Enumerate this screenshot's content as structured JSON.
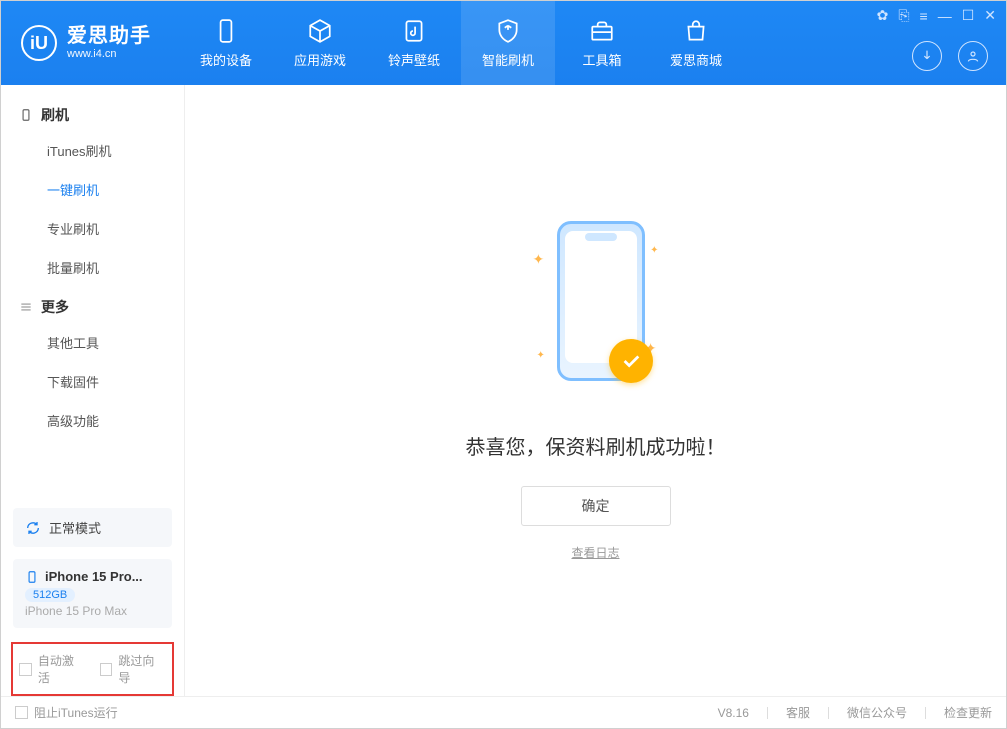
{
  "app": {
    "name_cn": "爱思助手",
    "url": "www.i4.cn",
    "logo_letters": "iU"
  },
  "nav": {
    "items": [
      {
        "label": "我的设备",
        "icon": "phone"
      },
      {
        "label": "应用游戏",
        "icon": "cube"
      },
      {
        "label": "铃声壁纸",
        "icon": "music"
      },
      {
        "label": "智能刷机",
        "icon": "shield",
        "active": true
      },
      {
        "label": "工具箱",
        "icon": "toolbox"
      },
      {
        "label": "爱思商城",
        "icon": "bag"
      }
    ]
  },
  "sidebar": {
    "group1": {
      "title": "刷机",
      "items": [
        "iTunes刷机",
        "一键刷机",
        "专业刷机",
        "批量刷机"
      ],
      "active_index": 1
    },
    "group2": {
      "title": "更多",
      "items": [
        "其他工具",
        "下载固件",
        "高级功能"
      ]
    }
  },
  "device_panel": {
    "mode_label": "正常模式",
    "name": "iPhone 15 Pro...",
    "storage": "512GB",
    "model": "iPhone 15 Pro Max"
  },
  "checkboxes": {
    "auto_activate": "自动激活",
    "skip_wizard": "跳过向导"
  },
  "main": {
    "success_text": "恭喜您，保资料刷机成功啦！",
    "ok_button": "确定",
    "view_log": "查看日志"
  },
  "footer": {
    "block_itunes": "阻止iTunes运行",
    "version": "V8.16",
    "links": [
      "客服",
      "微信公众号",
      "检查更新"
    ]
  }
}
